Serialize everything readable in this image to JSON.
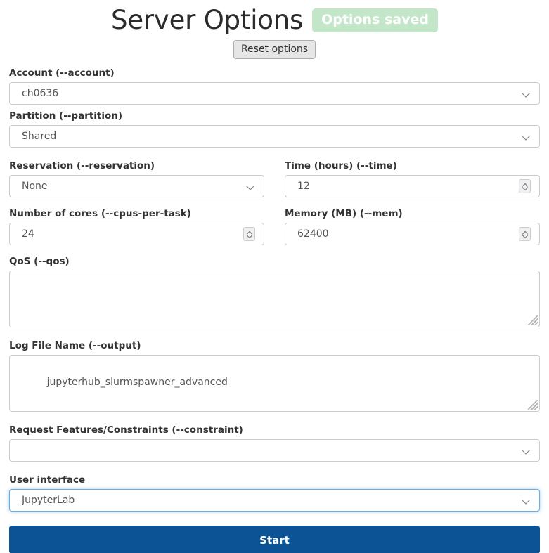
{
  "header": {
    "title": "Server Options",
    "saved_badge": "Options saved",
    "reset_label": "Reset options"
  },
  "form": {
    "account": {
      "label": "Account (--account)",
      "value": "ch0636",
      "type": "select",
      "focused": false
    },
    "partition": {
      "label": "Partition (--partition)",
      "value": "Shared",
      "type": "select",
      "focused": false
    },
    "reservation": {
      "label": "Reservation (--reservation)",
      "value": "None",
      "type": "select",
      "focused": false
    },
    "time": {
      "label": "Time (hours) (--time)",
      "value": "12",
      "type": "number",
      "focused": false
    },
    "cores": {
      "label": "Number of cores (--cpus-per-task)",
      "value": "24",
      "type": "number",
      "focused": false
    },
    "memory": {
      "label": "Memory (MB) (--mem)",
      "value": "62400",
      "type": "number",
      "focused": false
    },
    "qos": {
      "label": "QoS (--qos)",
      "value": "",
      "type": "textarea",
      "focused": false
    },
    "logfile": {
      "label": "Log File Name (--output)",
      "value": "jupyterhub_slurmspawner_advanced",
      "type": "textarea",
      "focused": false
    },
    "constraint": {
      "label": "Request Features/Constraints (--constraint)",
      "value": "",
      "type": "select",
      "focused": false
    },
    "user_interface": {
      "label": "User interface",
      "value": "JupyterLab",
      "type": "select",
      "focused": true
    }
  },
  "submit": {
    "label": "Start"
  },
  "colors": {
    "badge_bg": "#c3e6c8",
    "start_bg": "#0b5394",
    "focus_border": "#66afe9",
    "border": "#cccccc",
    "text": "#333333"
  },
  "icons": {
    "caret": "chevron-down-icon",
    "spinner_up": "chevron-up-icon",
    "spinner_down": "chevron-down-icon",
    "resize": "resize-handle-icon"
  }
}
